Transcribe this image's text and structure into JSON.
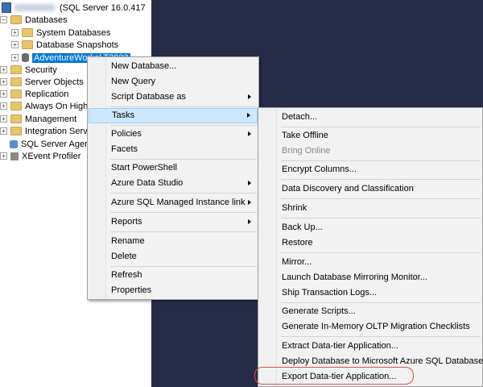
{
  "tree": {
    "server_label": "(SQL Server 16.0.417",
    "databases_label": "Databases",
    "system_databases_label": "System Databases",
    "database_snapshots_label": "Database Snapshots",
    "selected_db_label": "AdventureWorksLT2022",
    "security_label": "Security",
    "server_objects_label": "Server Objects",
    "replication_label": "Replication",
    "always_on_label": "Always On High A",
    "management_label": "Management",
    "integration_label": "Integration Servic",
    "agent_label": "SQL Server Agent",
    "xevent_label": "XEvent Profiler",
    "expand_glyph": "+",
    "collapse_glyph": "−"
  },
  "context_menu": {
    "new_database": "New Database...",
    "new_query": "New Query",
    "script_database_as": "Script Database as",
    "tasks": "Tasks",
    "policies": "Policies",
    "facets": "Facets",
    "start_powershell": "Start PowerShell",
    "azure_data_studio": "Azure Data Studio",
    "azure_sql_mi_link": "Azure SQL Managed Instance link",
    "reports": "Reports",
    "rename": "Rename",
    "delete": "Delete",
    "refresh": "Refresh",
    "properties": "Properties"
  },
  "tasks_menu": {
    "detach": "Detach...",
    "take_offline": "Take Offline",
    "bring_online": "Bring Online",
    "encrypt_columns": "Encrypt Columns...",
    "data_discovery": "Data Discovery and Classification",
    "shrink": "Shrink",
    "back_up": "Back Up...",
    "restore": "Restore",
    "mirror": "Mirror...",
    "launch_mirroring_monitor": "Launch Database Mirroring Monitor...",
    "ship_transaction_logs": "Ship Transaction Logs...",
    "generate_scripts": "Generate Scripts...",
    "generate_inmemory": "Generate In-Memory OLTP Migration Checklists",
    "extract_data_tier": "Extract Data-tier Application...",
    "deploy_to_azure": "Deploy Database to Microsoft Azure SQL Database...",
    "export_data_tier": "Export Data-tier Application..."
  },
  "colors": {
    "dark_pane": "#262b47",
    "selection": "#0078d7",
    "menu_highlight": "#cce8ff",
    "annotation_red": "#d9534f"
  }
}
